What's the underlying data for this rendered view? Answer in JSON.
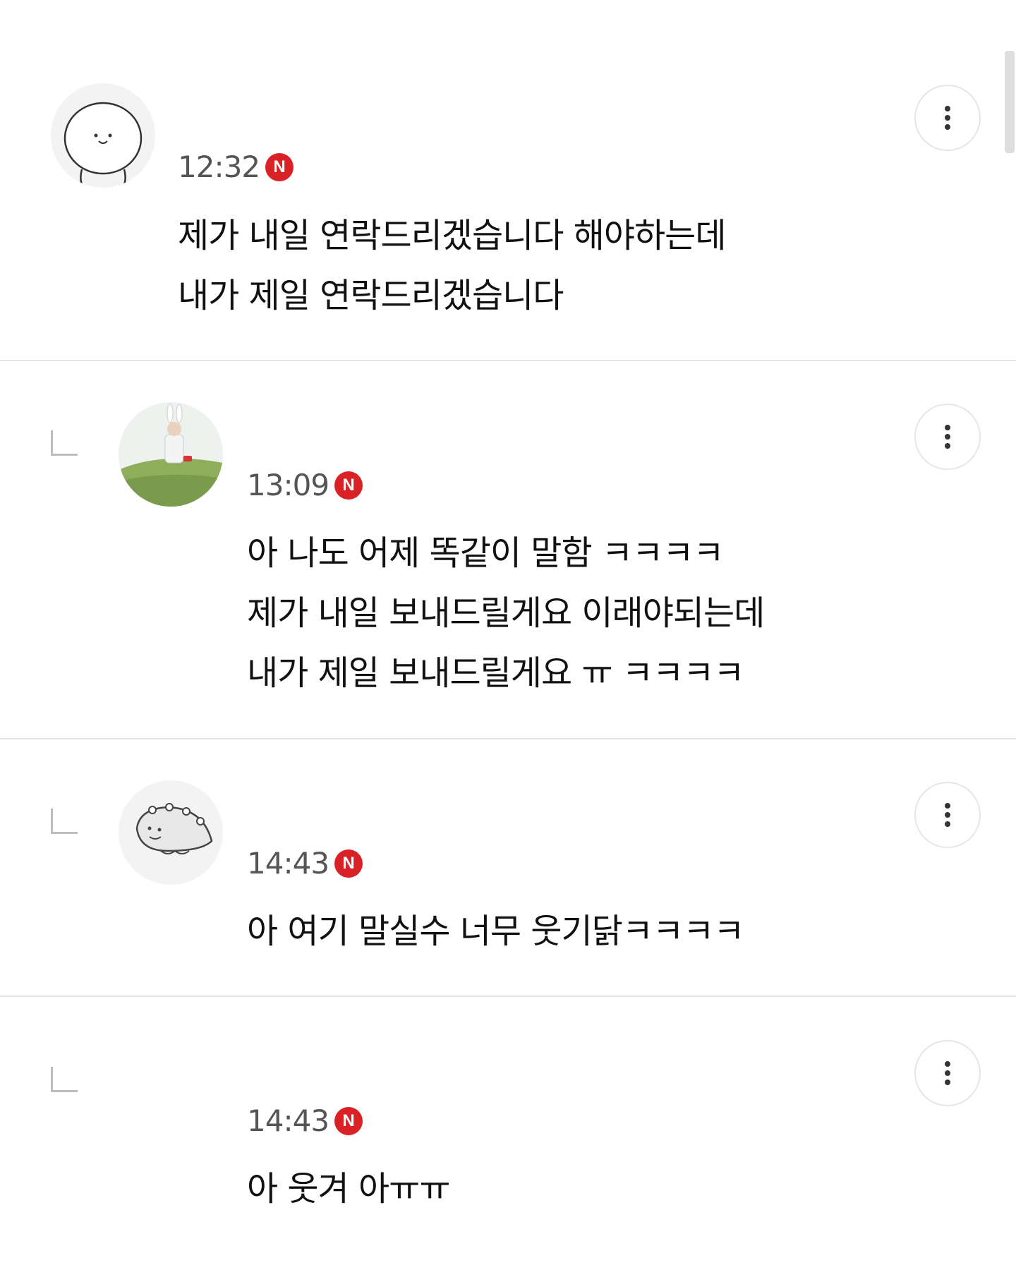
{
  "comments": [
    {
      "time": "12:32",
      "new_badge": "N",
      "lines": [
        "제가 내일 연락드리겠습니다 해야하는데",
        "내가 제일 연락드리겠습니다"
      ]
    },
    {
      "time": "13:09",
      "new_badge": "N",
      "lines": [
        "아 나도 어제 똑같이 말함 ㅋㅋㅋㅋ",
        "제가 내일 보내드릴게요 이래야되는데",
        "내가 제일 보내드릴게요 ㅠ ㅋㅋㅋㅋ"
      ]
    },
    {
      "time": "14:43",
      "new_badge": "N",
      "lines": [
        "아 여기 말실수 너무 웃기닭ㅋㅋㅋㅋ"
      ]
    },
    {
      "time": "14:43",
      "new_badge": "N",
      "lines": [
        "아 웃겨 아ㅠㅠ"
      ]
    }
  ],
  "icons": {
    "more": "more-vertical-icon",
    "reply": "reply-indent-icon",
    "new": "new-badge-icon"
  },
  "colors": {
    "new_badge": "#d92126",
    "divider": "#e5e5e5",
    "time_text": "#555555"
  }
}
